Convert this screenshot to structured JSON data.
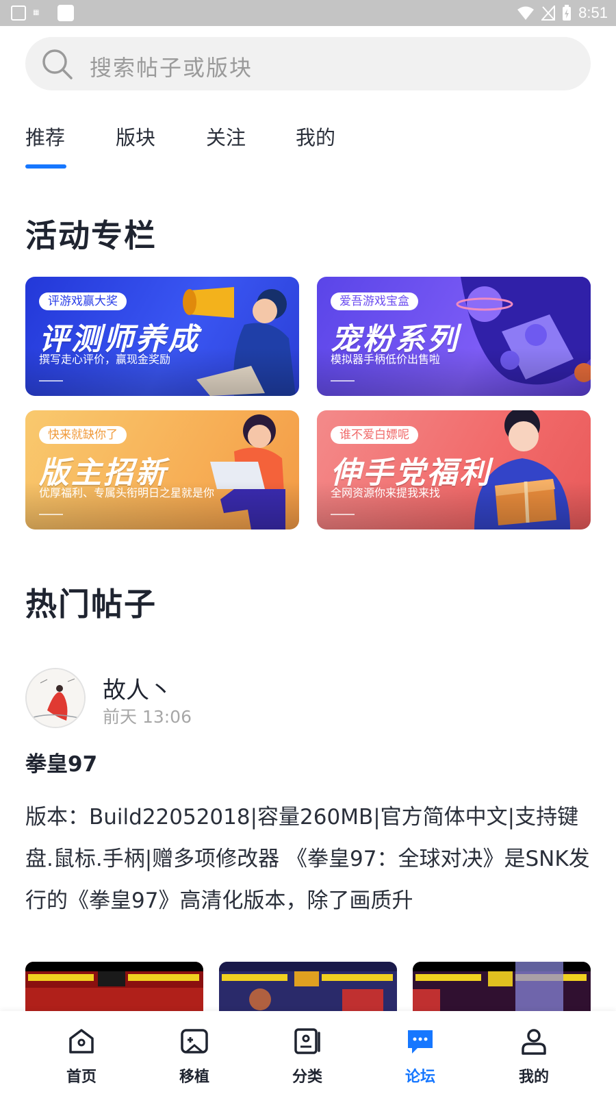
{
  "status_bar": {
    "time": "8:51"
  },
  "search": {
    "placeholder": "搜索帖子或版块"
  },
  "tabs": [
    {
      "label": "推荐",
      "active": true
    },
    {
      "label": "版块",
      "active": false
    },
    {
      "label": "关注",
      "active": false
    },
    {
      "label": "我的",
      "active": false
    }
  ],
  "activities": {
    "title": "活动专栏",
    "banners": [
      {
        "tag": "评游戏赢大奖",
        "title": "评测师养成",
        "subtitle": "撰写走心评价，赢现金奖励",
        "color": "#2a3ee8"
      },
      {
        "tag": "爱吾游戏宝盒",
        "title": "宠粉系列",
        "subtitle": "模拟器手柄低价出售啦",
        "color": "#6b4cf0"
      },
      {
        "tag": "快来就缺你了",
        "title": "版主招新",
        "subtitle": "优厚福利、专属头衔明日之星就是你",
        "color": "#f7a44a"
      },
      {
        "tag": "谁不爱白嫖呢",
        "title": "伸手党福利",
        "subtitle": "全网资源你来提我来找",
        "color": "#f06a6a"
      }
    ]
  },
  "hot_posts": {
    "title": "热门帖子",
    "post": {
      "author": "故人丶",
      "time": "前天 13:06",
      "title": "拳皇97",
      "body": "版本：Build22052018|容量260MB|官方简体中文|支持键盘.鼠标.手柄|赠多项修改器 《拳皇97：全球对决》是SNK发行的《拳皇97》高清化版本，除了画质升"
    }
  },
  "bottom_nav": [
    {
      "label": "首页",
      "icon": "home-icon",
      "active": false
    },
    {
      "label": "移植",
      "icon": "gamepad-icon",
      "active": false
    },
    {
      "label": "分类",
      "icon": "category-icon",
      "active": false
    },
    {
      "label": "论坛",
      "icon": "forum-icon",
      "active": true
    },
    {
      "label": "我的",
      "icon": "user-icon",
      "active": false
    }
  ],
  "colors": {
    "accent": "#1677ff"
  }
}
